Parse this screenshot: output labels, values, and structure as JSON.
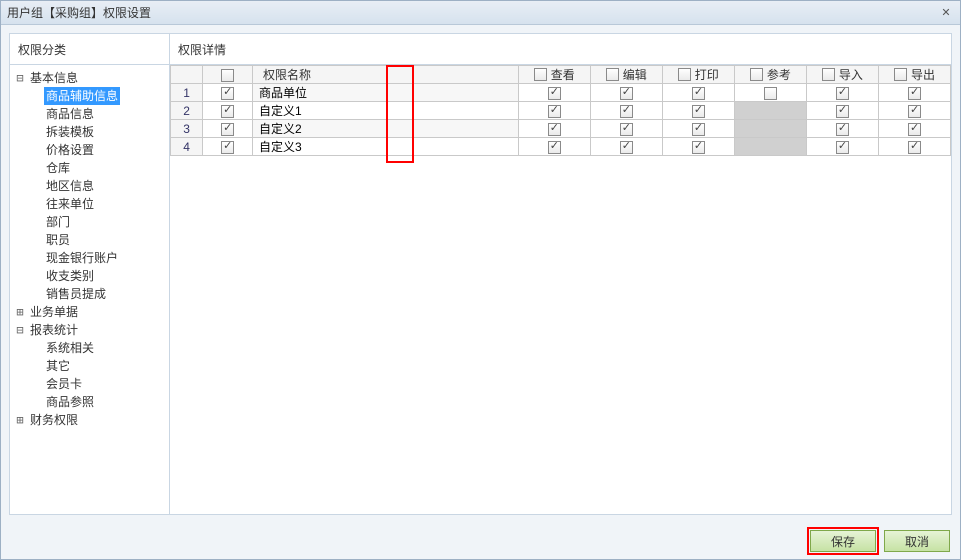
{
  "window": {
    "title": "用户组【采购组】权限设置"
  },
  "left": {
    "header": "权限分类",
    "nodes": [
      {
        "label": "基本信息",
        "expanded": true,
        "children": [
          {
            "label": "商品辅助信息",
            "selected": true
          },
          {
            "label": "商品信息"
          },
          {
            "label": "拆装模板"
          },
          {
            "label": "价格设置"
          },
          {
            "label": "仓库"
          },
          {
            "label": "地区信息"
          },
          {
            "label": "往来单位"
          },
          {
            "label": "部门"
          },
          {
            "label": "职员"
          },
          {
            "label": "现金银行账户"
          },
          {
            "label": "收支类别"
          },
          {
            "label": "销售员提成"
          }
        ]
      },
      {
        "label": "业务单据",
        "expanded": false
      },
      {
        "label": "报表统计",
        "expanded": true,
        "children": [
          {
            "label": "系统相关"
          },
          {
            "label": "其它"
          },
          {
            "label": "会员卡"
          },
          {
            "label": "商品参照"
          }
        ]
      },
      {
        "label": "财务权限",
        "expanded": false
      }
    ]
  },
  "right": {
    "header": "权限详情",
    "columns": {
      "name": "权限名称",
      "view": "查看",
      "edit": "编辑",
      "print": "打印",
      "ref": "参考",
      "import": "导入",
      "export": "导出"
    },
    "rows": [
      {
        "num": "1",
        "sel": true,
        "name": "商品单位",
        "view": true,
        "edit": true,
        "print": true,
        "ref": false,
        "ref_disabled": false,
        "import": true,
        "export": true
      },
      {
        "num": "2",
        "sel": true,
        "name": "自定义1",
        "view": true,
        "edit": true,
        "print": true,
        "ref": null,
        "ref_disabled": true,
        "import": true,
        "export": true
      },
      {
        "num": "3",
        "sel": true,
        "name": "自定义2",
        "view": true,
        "edit": true,
        "print": true,
        "ref": null,
        "ref_disabled": true,
        "import": true,
        "export": true
      },
      {
        "num": "4",
        "sel": true,
        "name": "自定义3",
        "view": true,
        "edit": true,
        "print": true,
        "ref": null,
        "ref_disabled": true,
        "import": true,
        "export": true
      }
    ]
  },
  "footer": {
    "save": "保存",
    "cancel": "取消"
  }
}
